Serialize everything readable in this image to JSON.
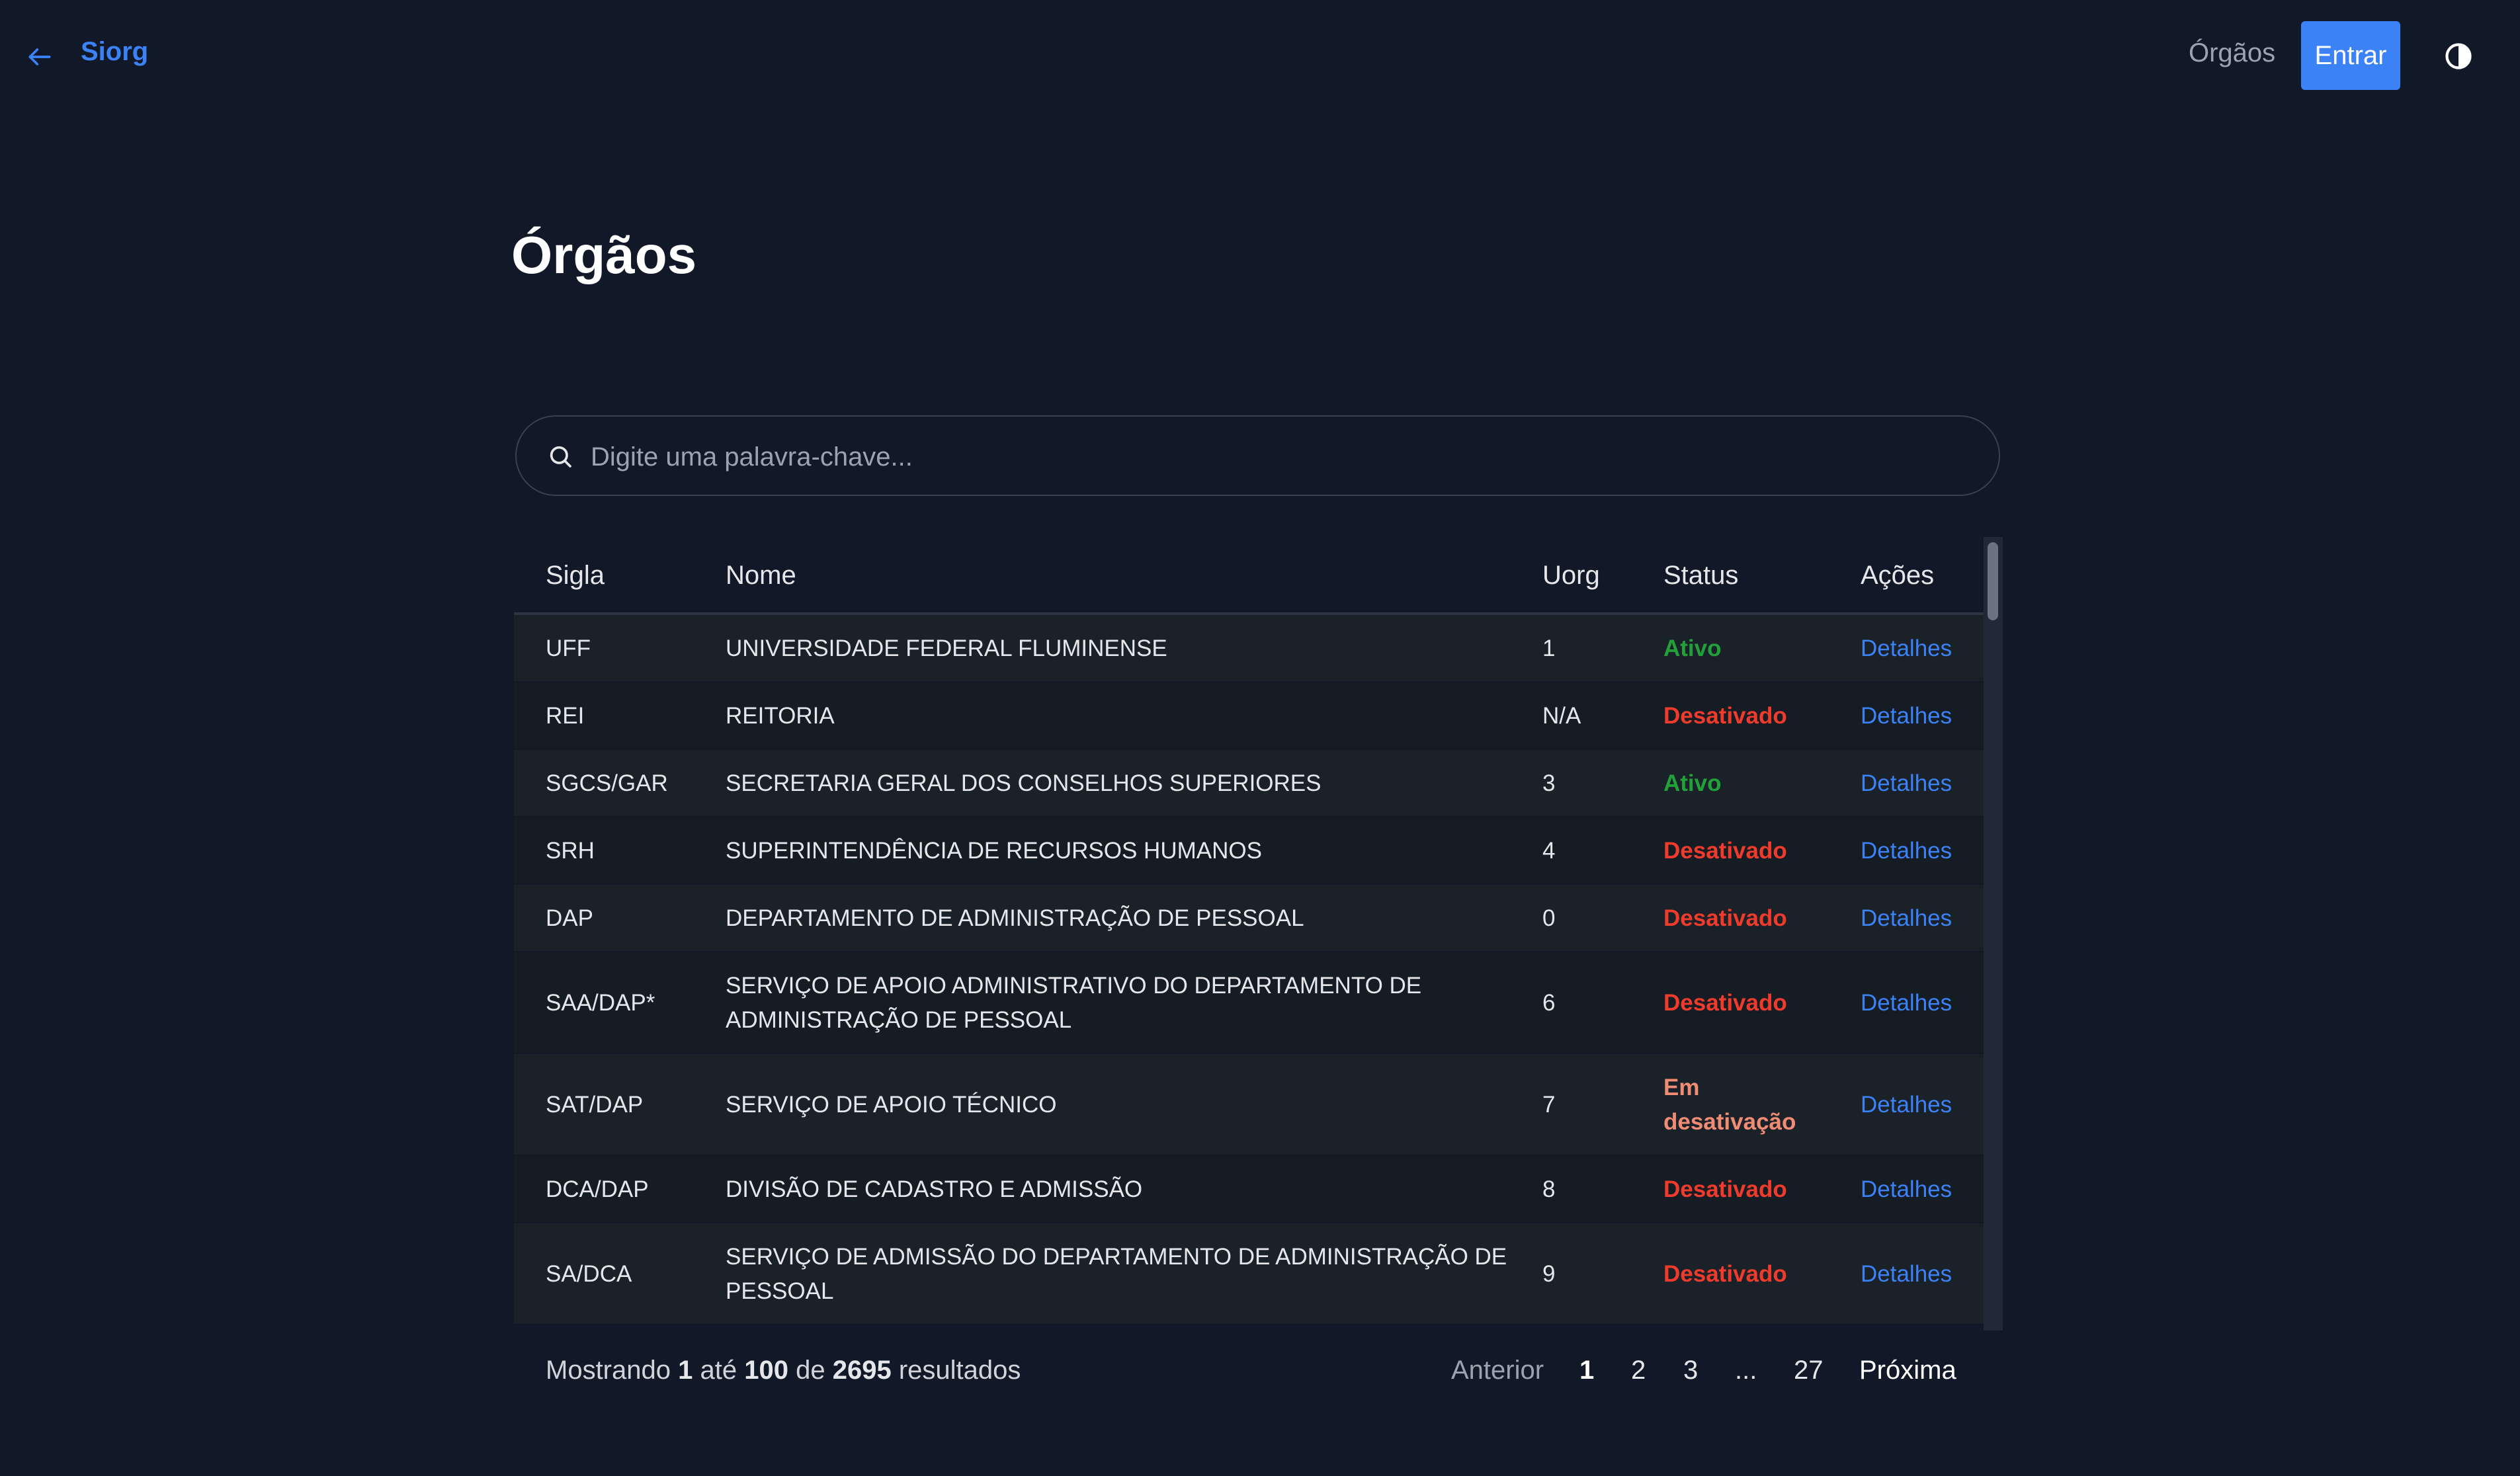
{
  "header": {
    "brand": "Siorg",
    "nav_orgaos": "Órgãos",
    "login_label": "Entrar",
    "icons": {
      "back": "arrow-left-icon",
      "theme": "contrast-icon"
    },
    "accent_color": "#3b82f6"
  },
  "page": {
    "title": "Órgãos"
  },
  "search": {
    "placeholder": "Digite uma palavra-chave...",
    "value": ""
  },
  "table": {
    "columns": [
      "Sigla",
      "Nome",
      "Uorg",
      "Status",
      "Ações"
    ],
    "rows": [
      {
        "sigla": "UFF",
        "nome": [
          "UNIVERSIDADE FEDERAL FLUMINENSE"
        ],
        "uorg": "1",
        "status": [
          "Ativo"
        ],
        "status_kind": "ativo",
        "acao": "Detalhes"
      },
      {
        "sigla": "REI",
        "nome": [
          "REITORIA"
        ],
        "uorg": "N/A",
        "status": [
          "Desativado"
        ],
        "status_kind": "desativado",
        "acao": "Detalhes"
      },
      {
        "sigla": "SGCS/GAR",
        "nome": [
          "SECRETARIA GERAL DOS CONSELHOS SUPERIORES"
        ],
        "uorg": "3",
        "status": [
          "Ativo"
        ],
        "status_kind": "ativo",
        "acao": "Detalhes"
      },
      {
        "sigla": "SRH",
        "nome": [
          "SUPERINTENDÊNCIA DE RECURSOS HUMANOS"
        ],
        "uorg": "4",
        "status": [
          "Desativado"
        ],
        "status_kind": "desativado",
        "acao": "Detalhes"
      },
      {
        "sigla": "DAP",
        "nome": [
          "DEPARTAMENTO DE ADMINISTRAÇÃO DE PESSOAL"
        ],
        "uorg": "0",
        "status": [
          "Desativado"
        ],
        "status_kind": "desativado",
        "acao": "Detalhes"
      },
      {
        "sigla": "SAA/DAP*",
        "nome": [
          "SERVIÇO DE APOIO ADMINISTRATIVO DO DEPARTAMENTO DE",
          "ADMINISTRAÇÃO DE PESSOAL"
        ],
        "uorg": "6",
        "status": [
          "Desativado"
        ],
        "status_kind": "desativado",
        "acao": "Detalhes"
      },
      {
        "sigla": "SAT/DAP",
        "nome": [
          "SERVIÇO DE APOIO TÉCNICO"
        ],
        "uorg": "7",
        "status": [
          "Em",
          "desativação"
        ],
        "status_kind": "em_desativacao",
        "acao": "Detalhes"
      },
      {
        "sigla": "DCA/DAP",
        "nome": [
          "DIVISÃO DE CADASTRO E ADMISSÃO"
        ],
        "uorg": "8",
        "status": [
          "Desativado"
        ],
        "status_kind": "desativado",
        "acao": "Detalhes"
      },
      {
        "sigla": "SA/DCA",
        "nome": [
          "SERVIÇO DE ADMISSÃO DO DEPARTAMENTO DE ADMINISTRAÇÃO DE",
          "PESSOAL"
        ],
        "uorg": "9",
        "status": [
          "Desativado"
        ],
        "status_kind": "desativado",
        "acao": "Detalhes"
      }
    ]
  },
  "status_colors": {
    "ativo": "#22a13a",
    "desativado": "#ef3b2c",
    "em_desativacao": "#f08b74"
  },
  "footer": {
    "prefix": "Mostrando",
    "from": "1",
    "mid1": "até",
    "to": "100",
    "mid2": "de",
    "total": "2695",
    "suffix": "resultados"
  },
  "pagination": {
    "prev": "Anterior",
    "pages": [
      "1",
      "2",
      "3",
      "...",
      "27"
    ],
    "current": "1",
    "next": "Próxima"
  }
}
